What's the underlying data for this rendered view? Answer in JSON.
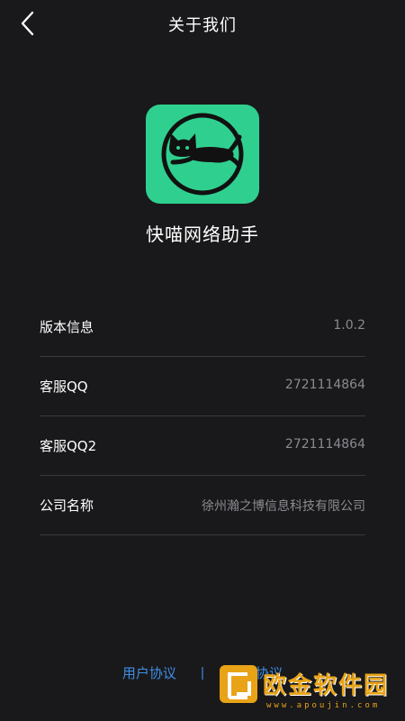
{
  "header": {
    "title": "关于我们",
    "back_icon": "chevron-left-icon"
  },
  "app": {
    "name": "快喵网络助手",
    "logo_icon": "running-cat-icon",
    "logo_color": "#2fd08f"
  },
  "info": [
    {
      "label": "版本信息",
      "value": "1.0.2"
    },
    {
      "label": "客服QQ",
      "value": "2721114864"
    },
    {
      "label": "客服QQ2",
      "value": "2721114864"
    },
    {
      "label": "公司名称",
      "value": "徐州瀚之博信息科技有限公司"
    }
  ],
  "footer": {
    "user_agreement": "用户协议",
    "separator": "|",
    "privacy_policy": "隐私协议",
    "link_color": "#3f8ee6"
  },
  "watermark": {
    "text": "欧金软件园",
    "url": "www.apoujin.com"
  }
}
